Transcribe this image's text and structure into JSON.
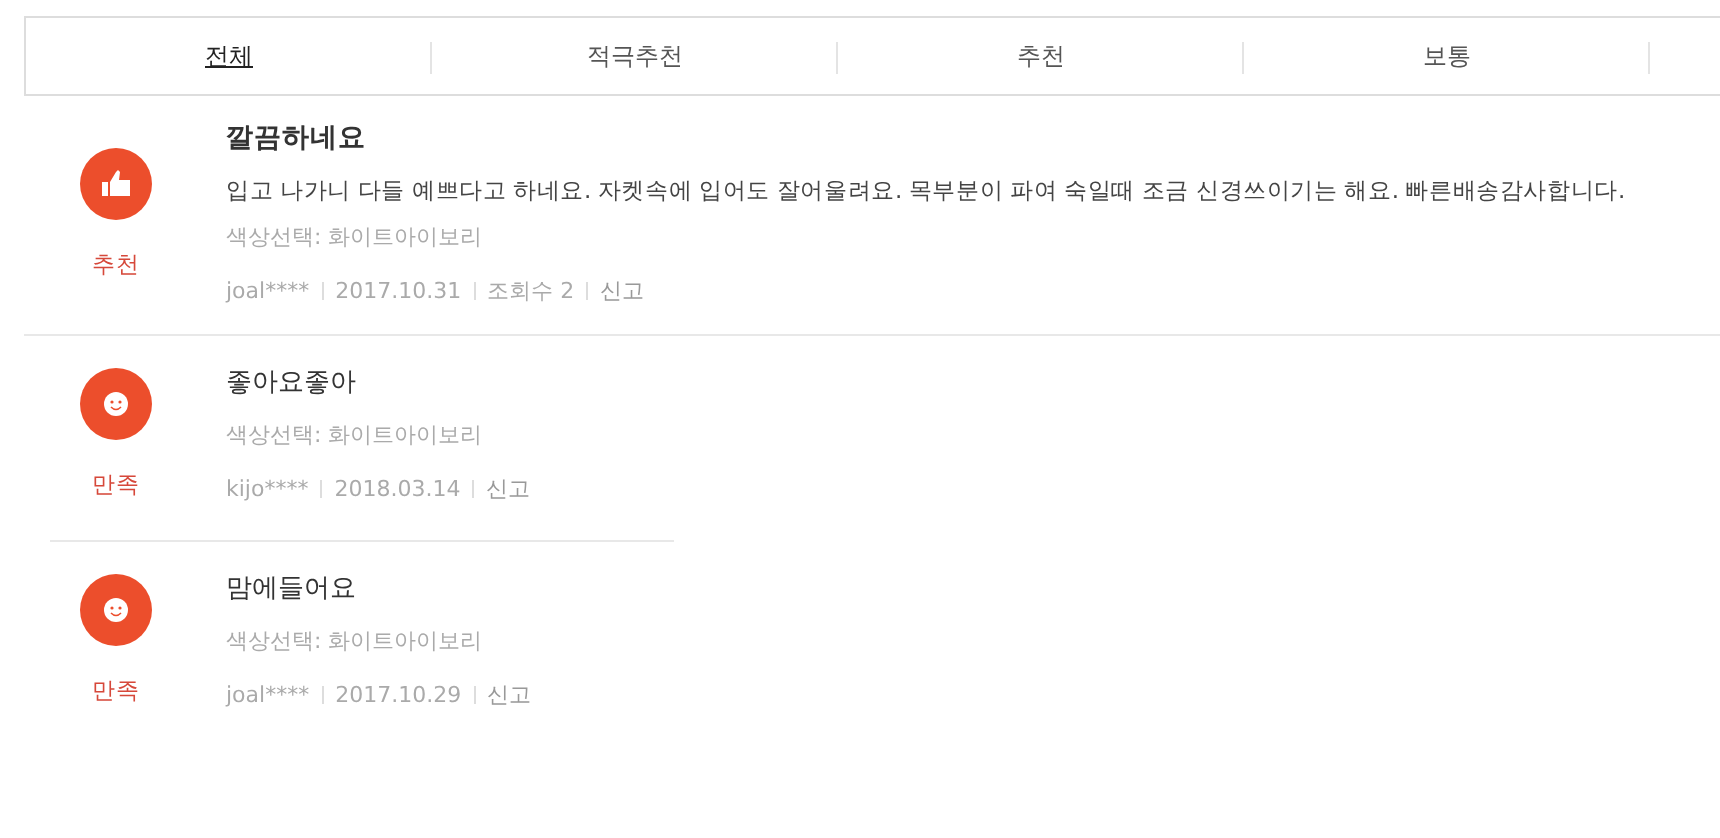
{
  "tabs": [
    {
      "label": "전체",
      "selected": true
    },
    {
      "label": "적극추천",
      "selected": false
    },
    {
      "label": "추천",
      "selected": false
    },
    {
      "label": "보통",
      "selected": false
    }
  ],
  "reviews": [
    {
      "kind": "recommend",
      "rating": "추천",
      "title": "깔끔하네요",
      "body": "입고 나가니 다들 예쁘다고 하네요. 자켓속에 입어도 잘어울려요. 목부분이 파여 숙일때 조금 신경쓰이기는 해요. 빠른배송감사합니다.",
      "option": "색상선택: 화이트아이보리",
      "user": "joal****",
      "date": "2017.10.31",
      "views": "조회수 2",
      "report": "신고"
    },
    {
      "kind": "satisfied",
      "rating": "만족",
      "title": "좋아요좋아",
      "option": "색상선택: 화이트아이보리",
      "user": "kijo****",
      "date": "2018.03.14",
      "report": "신고"
    },
    {
      "kind": "satisfied",
      "rating": "만족",
      "title": "맘에들어요",
      "option": "색상선택: 화이트아이보리",
      "user": "joal****",
      "date": "2017.10.29",
      "report": "신고"
    }
  ]
}
